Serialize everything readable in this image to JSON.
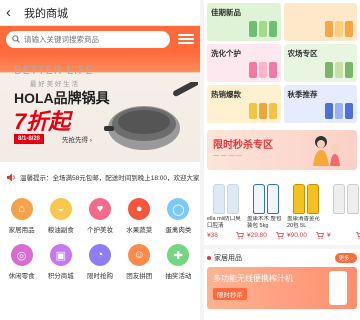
{
  "left": {
    "header": {
      "title": "我的商城"
    },
    "search": {
      "placeholder": "请输入关键词搜索商品"
    },
    "banner": {
      "brand": "BETTER LIFE",
      "brand_sub": "最 好 美 好 生 活",
      "headline": "HOLA品牌锅具",
      "discount": "7折起",
      "date": "8/1-8/28",
      "cta": "先抢先得 ›"
    },
    "notice": {
      "text": "温馨提示：全场满58元包邮，配送时间到晚上18:00，欢迎大家"
    },
    "categories": [
      {
        "label": "家居用品",
        "icon": "sofa-icon",
        "color": "#f6a24a"
      },
      {
        "label": "粮油副食",
        "icon": "rice-bowl-icon",
        "color": "#f9c74f"
      },
      {
        "label": "个护美妆",
        "icon": "lipstick-icon",
        "color": "#f56a8a"
      },
      {
        "label": "水果蔬菜",
        "icon": "apple-icon",
        "color": "#f4553b"
      },
      {
        "label": "蛋禽肉类",
        "icon": "egg-icon",
        "color": "#7ec8f6"
      },
      {
        "label": "休闲零食",
        "icon": "lollipop-icon",
        "color": "#d96bd2"
      },
      {
        "label": "积分商城",
        "icon": "shop-icon",
        "color": "#c678f0"
      },
      {
        "label": "限时抢购",
        "icon": "clock-icon",
        "color": "#8e7df7"
      },
      {
        "label": "团友拼团",
        "icon": "group-icon",
        "color": "#ff8a4c"
      },
      {
        "label": "抽奖活动",
        "icon": "gift-icon",
        "color": "#74d680"
      }
    ]
  },
  "right": {
    "tiles": [
      {
        "label": "佳期新品",
        "bg": "#dff3d6"
      },
      {
        "label": "",
        "bg": "#ffe7c9"
      },
      {
        "label": "洗化个护",
        "bg": "#fde8ef"
      },
      {
        "label": "农场专区",
        "bg": "#e7f5e1"
      },
      {
        "label": "热销爆款",
        "bg": "#fff1cf"
      },
      {
        "label": "秋季推荐",
        "bg": "#e5ecfd"
      }
    ],
    "flash": {
      "title": "限时秒杀专区",
      "subtitle": "— — — —"
    },
    "products": [
      {
        "name": "ella mii防口臭口腔清",
        "price": "¥38"
      },
      {
        "name": "盈康木木 整包装包 5kg",
        "price": "¥29.80"
      },
      {
        "name": "盈康清香金花 20包 5L",
        "price": "¥90.00"
      },
      {
        "name": "",
        "price": "¥"
      }
    ],
    "section": {
      "title": "家居用品",
      "more": "更多 ›",
      "promo": "多功能无线便携榨汁机",
      "promo_tag": "限时秒杀"
    }
  }
}
